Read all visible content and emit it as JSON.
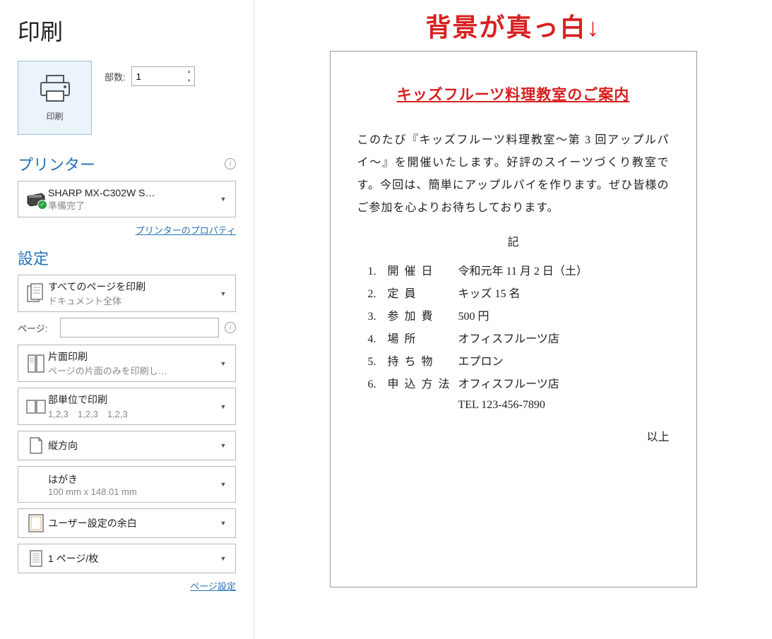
{
  "page_title": "印刷",
  "print_button_label": "印刷",
  "copies": {
    "label": "部数:",
    "value": "1"
  },
  "printer": {
    "section": "プリンター",
    "name": "SHARP MX-C302W S…",
    "status": "準備完了",
    "properties_link": "プリンターのプロパティ"
  },
  "settings": {
    "section": "設定",
    "print_range": {
      "main": "すべてのページを印刷",
      "sub": "ドキュメント全体"
    },
    "pages": {
      "label": "ページ:",
      "value": ""
    },
    "sides": {
      "main": "片面印刷",
      "sub": "ページの片面のみを印刷し…"
    },
    "collate": {
      "main": "部単位で印刷",
      "sub": "1,2,3　1,2,3　1,2,3"
    },
    "orientation": {
      "main": "縦方向"
    },
    "paper": {
      "main": "はがき",
      "sub": "100 mm x 148.01 mm"
    },
    "margins": {
      "main": "ユーザー設定の余白"
    },
    "pages_per_sheet": {
      "main": "1 ページ/枚"
    },
    "page_setup_link": "ページ設定"
  },
  "annotation": "背景が真っ白↓",
  "document": {
    "title": "キッズフルーツ料理教室のご案内",
    "body": "このたび『キッズフルーツ料理教室～第 3 回アップルパイ～』を開催いたします。好評のスイーツづくり教室です。今回は、簡単にアップルパイを作ります。ぜひ皆様のご参加を心よりお待ちしております。",
    "ki": "記",
    "items": [
      {
        "num": "1.",
        "key": "開催日",
        "val": "令和元年 11 月 2 日（土）"
      },
      {
        "num": "2.",
        "key": "定員",
        "val": "キッズ 15 名"
      },
      {
        "num": "3.",
        "key": "参加費",
        "val": "500 円"
      },
      {
        "num": "4.",
        "key": "場所",
        "val": "オフィスフルーツ店"
      },
      {
        "num": "5.",
        "key": "持ち物",
        "val": "エプロン"
      },
      {
        "num": "6.",
        "key": "申込方法",
        "val": "オフィスフルーツ店"
      }
    ],
    "tel": "TEL 123-456-7890",
    "ijo": "以上"
  }
}
